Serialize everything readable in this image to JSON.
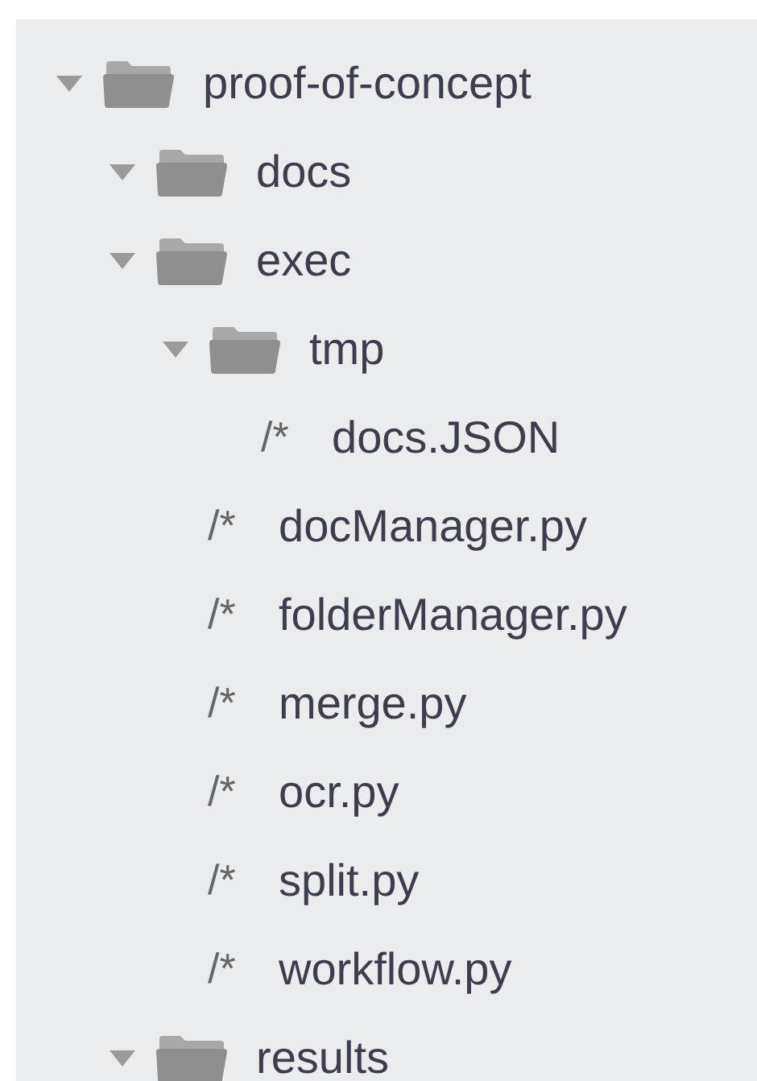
{
  "tree": [
    {
      "kind": "folder",
      "label": "proof-of-concept",
      "expanded": true,
      "children": [
        {
          "kind": "folder",
          "label": "docs",
          "expanded": true
        },
        {
          "kind": "folder",
          "label": "exec",
          "expanded": true,
          "children": [
            {
              "kind": "folder",
              "label": "tmp",
              "expanded": true,
              "children": [
                {
                  "kind": "file",
                  "icon": "/*",
                  "label": "docs.JSON"
                }
              ]
            },
            {
              "kind": "file",
              "icon": "/*",
              "label": "docManager.py"
            },
            {
              "kind": "file",
              "icon": "/*",
              "label": "folderManager.py"
            },
            {
              "kind": "file",
              "icon": "/*",
              "label": "merge.py"
            },
            {
              "kind": "file",
              "icon": "/*",
              "label": "ocr.py"
            },
            {
              "kind": "file",
              "icon": "/*",
              "label": "split.py"
            },
            {
              "kind": "file",
              "icon": "/*",
              "label": "workflow.py"
            }
          ]
        },
        {
          "kind": "folder",
          "label": "results",
          "expanded": true
        }
      ]
    }
  ]
}
